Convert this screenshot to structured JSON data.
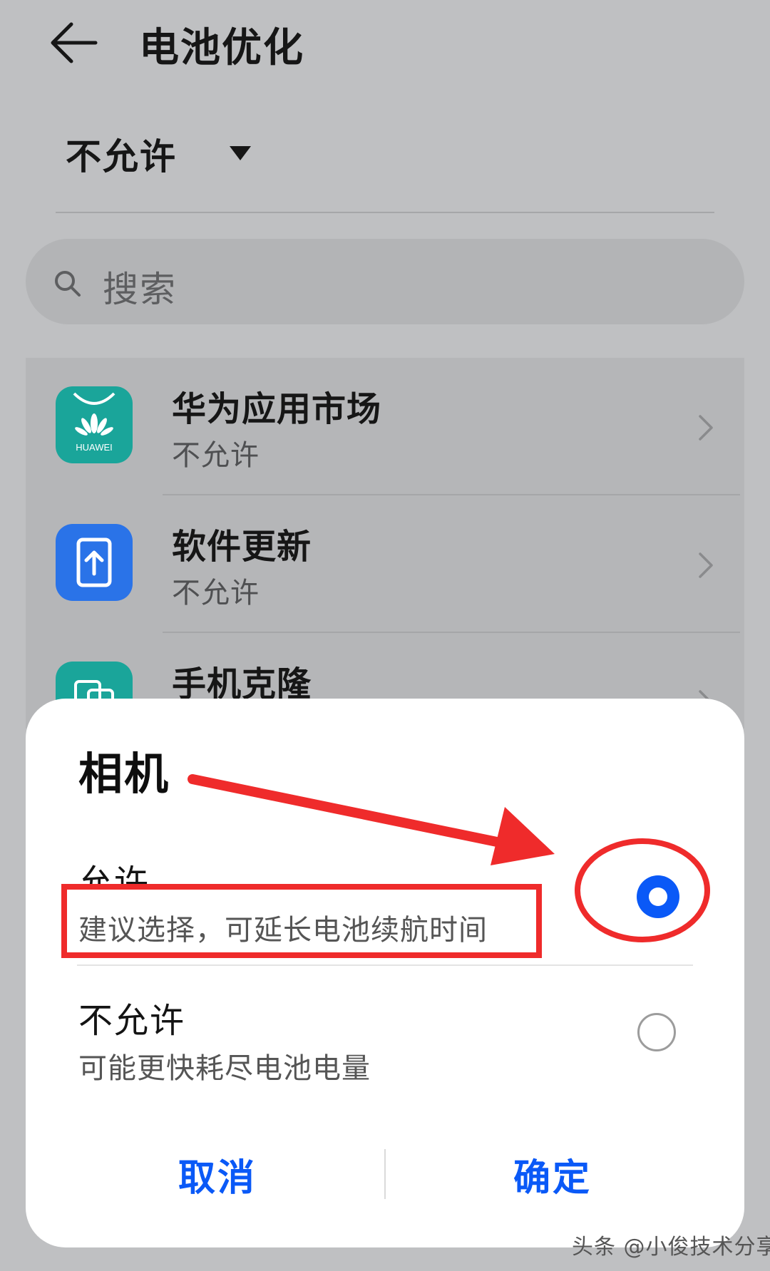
{
  "header": {
    "title": "电池优化",
    "back_icon": "arrow-left-icon"
  },
  "filter": {
    "selected": "不允许",
    "icon": "caret-down-icon"
  },
  "search": {
    "placeholder": "搜索",
    "icon": "search-icon"
  },
  "apps": [
    {
      "name": "华为应用市场",
      "status": "不允许",
      "icon": "huawei-appgallery-icon",
      "icon_label": "HUAWEI",
      "color": "#1aa59a"
    },
    {
      "name": "软件更新",
      "status": "不允许",
      "icon": "software-update-icon",
      "color": "#2a73e8"
    },
    {
      "name": "手机克隆",
      "status": "",
      "icon": "phone-clone-icon",
      "color": "#1aa59a"
    }
  ],
  "dialog": {
    "title": "相机",
    "options": [
      {
        "title": "允许",
        "subtitle": "建议选择，可延长电池续航时间",
        "selected": true
      },
      {
        "title": "不允许",
        "subtitle": "可能更快耗尽电池电量",
        "selected": false
      }
    ],
    "cancel_label": "取消",
    "confirm_label": "确定",
    "accent_color": "#0a59f7"
  },
  "annotation_color": "#ef2b2b",
  "watermark": "头条 @小俊技术分享"
}
